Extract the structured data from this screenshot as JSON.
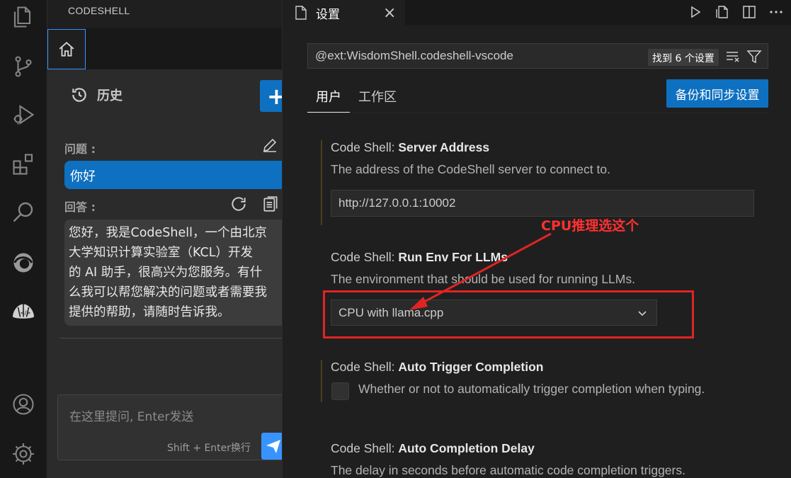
{
  "activity_bar": {
    "icons": [
      "explorer-icon",
      "source-control-icon",
      "run-debug-icon",
      "extensions-icon",
      "search-icon",
      "edge-icon",
      "codeshell-icon",
      "account-icon",
      "settings-gear-icon"
    ]
  },
  "sidebar": {
    "title": "CODESHELL",
    "history_label": "历史",
    "plus_label": "+",
    "question_label": "问题 :",
    "question_text": "你好",
    "answer_label": "回答 :",
    "answer_lines": [
      "您好，我是CodeShell，一个由北京",
      "大学知识计算实验室（KCL）开发",
      "的 AI 助手，很高兴为您服务。有什",
      "么我可以帮您解决的问题或者需要我",
      "提供的帮助，请随时告诉我。"
    ],
    "input_placeholder": "在这里提问, Enter发送",
    "input_hint": "Shift + Enter换行"
  },
  "editor": {
    "tab_title": "设置",
    "tab_close": "×",
    "search_value": "@ext:WisdomShell.codeshell-vscode",
    "found_badge": "找到 6 个设置",
    "tab_user": "用户",
    "tab_workspace": "工作区",
    "backup_button": "备份和同步设置",
    "settings": [
      {
        "category": "Code Shell: ",
        "name": "Server Address",
        "description": "The address of the CodeShell server to connect to.",
        "value": "http://127.0.0.1:10002"
      },
      {
        "category": "Code Shell: ",
        "name": "Run Env For LLMs",
        "description": "The environment that should be used for running LLMs.",
        "value": "CPU with llama.cpp"
      },
      {
        "category": "Code Shell: ",
        "name": "Auto Trigger Completion",
        "description": "Whether or not to automatically trigger completion when typing.",
        "checked": false
      },
      {
        "category": "Code Shell: ",
        "name": "Auto Completion Delay",
        "description": "The delay in seconds before automatic code completion triggers."
      }
    ]
  },
  "annotation": {
    "text": "CPU推理选这个",
    "color": "#e02424"
  }
}
